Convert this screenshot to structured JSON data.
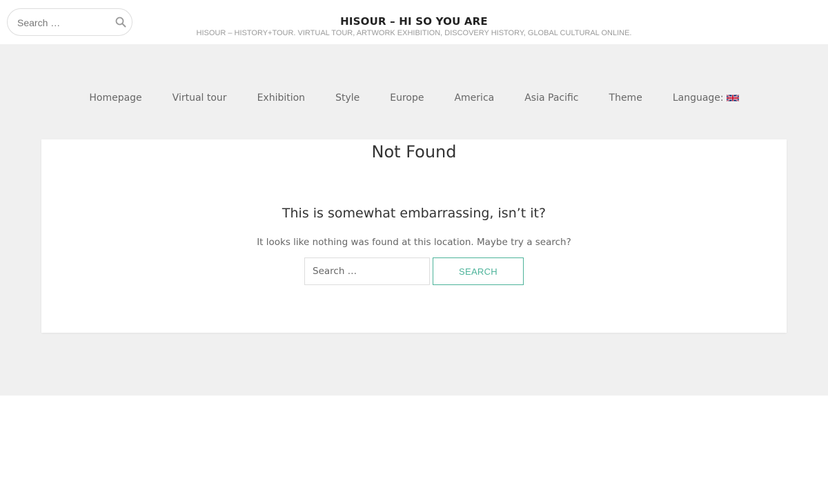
{
  "header": {
    "search": {
      "placeholder": "Search …",
      "value": "",
      "icon": "search-icon"
    },
    "site_title": "HISOUR – HI SO YOU ARE",
    "tagline": "HiSoUR – History+Tour. Virtual Tour, Artwork Exhibition, Discovery History, Global Cultural Online."
  },
  "nav": {
    "items": [
      {
        "label": "Homepage"
      },
      {
        "label": "Virtual tour"
      },
      {
        "label": "Exhibition"
      },
      {
        "label": "Style"
      },
      {
        "label": "Europe"
      },
      {
        "label": "America"
      },
      {
        "label": "Asia Pacific"
      },
      {
        "label": "Theme"
      },
      {
        "label": "Language:",
        "icon": "uk-flag-icon"
      }
    ]
  },
  "main": {
    "title": "Not Found",
    "subheading": "This is somewhat embarrassing, isn’t it?",
    "message": "It looks like nothing was found at this location. Maybe try a search?",
    "search": {
      "placeholder": "Search …",
      "value": "",
      "button_label": "Search"
    }
  },
  "colors": {
    "band_background": "#f0f0f0",
    "accent": "#4db39a",
    "text": "#333333",
    "muted": "#666666"
  }
}
